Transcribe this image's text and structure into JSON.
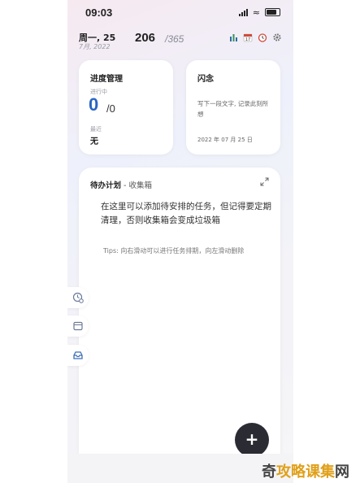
{
  "status_bar": {
    "time": "09:03"
  },
  "header": {
    "day": "周一, 25",
    "date": "7月, 2022",
    "count": "206",
    "total": "/365"
  },
  "toolbar_icons": [
    "bar-chart-icon",
    "calendar-icon",
    "alarm-clock-icon",
    "gear-icon"
  ],
  "progress_card": {
    "title": "进度管理",
    "in_progress_label": "进行中",
    "in_progress_value": "0",
    "slash_total": "/0",
    "recent_label": "最近",
    "recent_value": "无"
  },
  "flash_card": {
    "title": "闪念",
    "text": "写下一段文字, 记录此刻所想",
    "date": "2022 年 07 月 25 日"
  },
  "todo_card": {
    "title": "待办计划",
    "subtitle": " - 收集箱",
    "body": "在这里可以添加待安排的任务，但记得要定期清理，否则收集箱会变成垃圾箱",
    "tips": "Tips: 向右滑动可以进行任务排期，向左滑动删除"
  },
  "side_icons": [
    "clock-badge-icon",
    "calendar-panel-icon",
    "inbox-icon"
  ],
  "fab": {
    "label": "+"
  },
  "watermark": {
    "part1": "奇",
    "part2": "攻略课集",
    "part3": "网"
  },
  "colors": {
    "accent_blue": "#2a66c4",
    "fab": "#2b2c33",
    "watermark_gold": "#e0a019"
  }
}
